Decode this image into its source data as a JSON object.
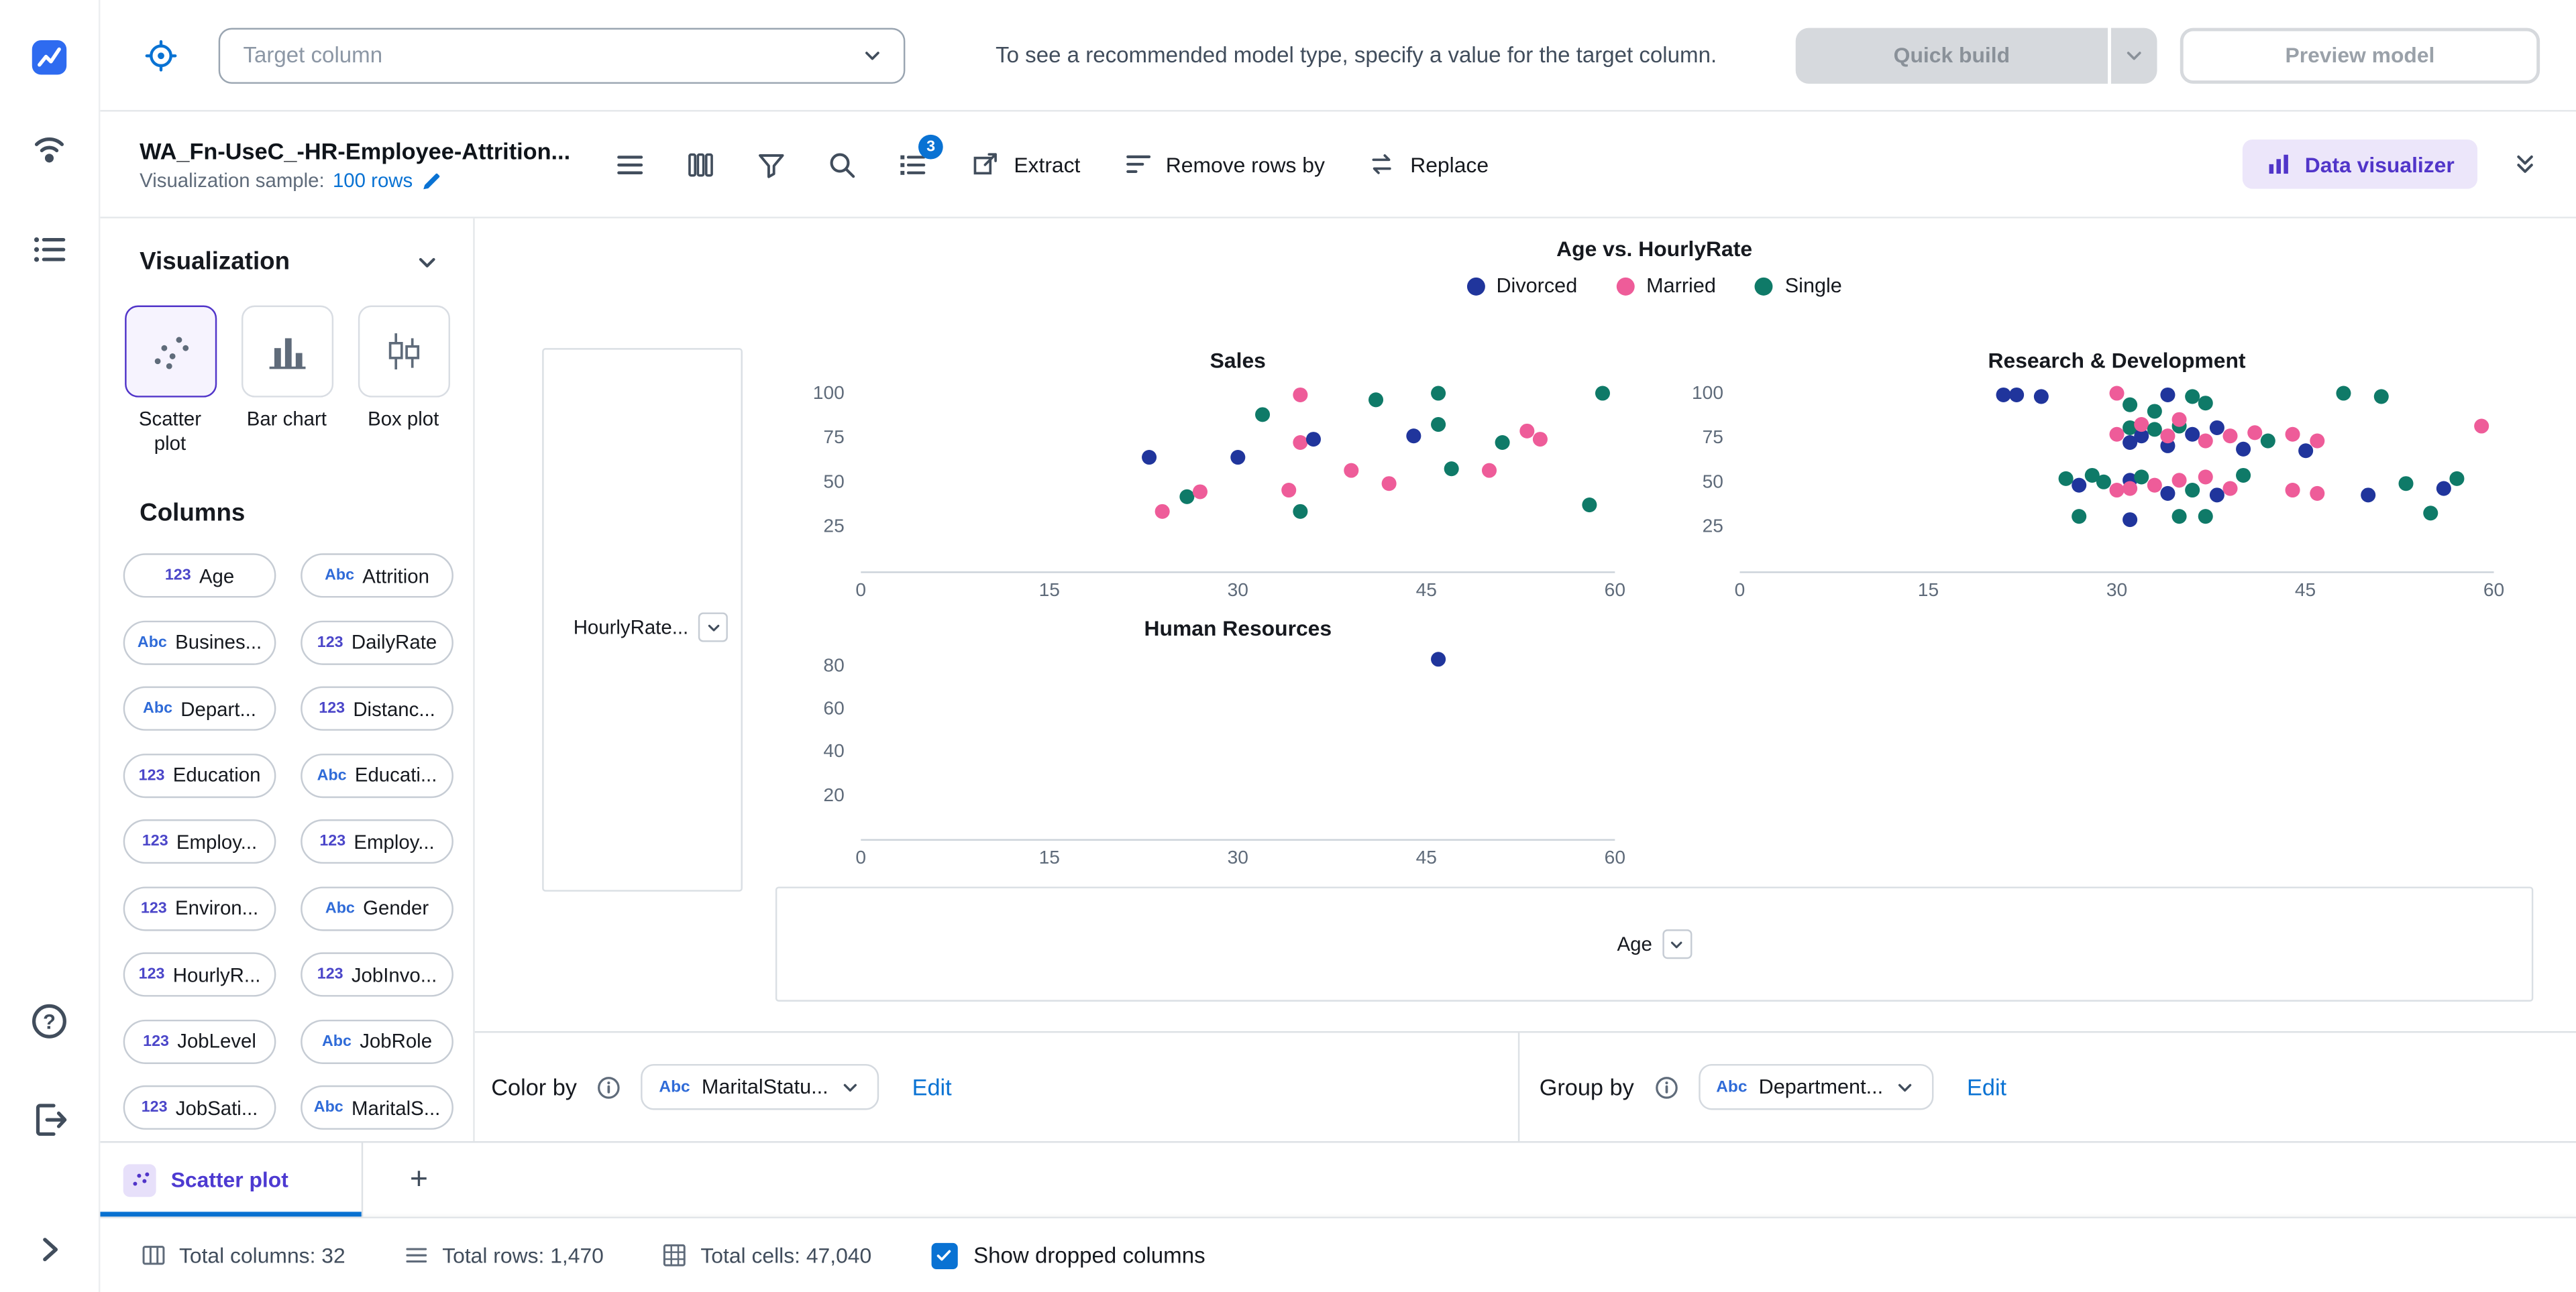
{
  "colors": {
    "accent": "#5135c9",
    "accent_bg": "#ece6fa",
    "link": "#0972d3",
    "disabled_bg": "#d6d9dd"
  },
  "header": {
    "target_placeholder": "Target column",
    "hint": "To see a recommended model type, specify a value for the target column.",
    "quick_build_label": "Quick build",
    "preview_model_label": "Preview model"
  },
  "toolbar": {
    "dataset_title": "WA_Fn-UseC_-HR-Employee-Attrition...",
    "sample_label": "Visualization sample:",
    "sample_value": "100 rows",
    "steps_badge": "3",
    "extract_label": "Extract",
    "remove_rows_label": "Remove rows by",
    "replace_label": "Replace",
    "data_visualizer_label": "Data visualizer"
  },
  "left_panel": {
    "visualization_title": "Visualization",
    "chart_types": [
      {
        "label": "Scatter plot",
        "selected": true
      },
      {
        "label": "Bar chart",
        "selected": false
      },
      {
        "label": "Box plot",
        "selected": false
      }
    ],
    "columns_title": "Columns",
    "columns": [
      {
        "kind": "123",
        "label": "Age"
      },
      {
        "kind": "Abc",
        "label": "Attrition"
      },
      {
        "kind": "Abc",
        "label": "Busines..."
      },
      {
        "kind": "123",
        "label": "DailyRate"
      },
      {
        "kind": "Abc",
        "label": "Depart..."
      },
      {
        "kind": "123",
        "label": "Distanc..."
      },
      {
        "kind": "123",
        "label": "Education"
      },
      {
        "kind": "Abc",
        "label": "Educati..."
      },
      {
        "kind": "123",
        "label": "Employ..."
      },
      {
        "kind": "123",
        "label": "Employ..."
      },
      {
        "kind": "123",
        "label": "Environ..."
      },
      {
        "kind": "Abc",
        "label": "Gender"
      },
      {
        "kind": "123",
        "label": "HourlyR..."
      },
      {
        "kind": "123",
        "label": "JobInvo..."
      },
      {
        "kind": "123",
        "label": "JobLevel"
      },
      {
        "kind": "Abc",
        "label": "JobRole"
      },
      {
        "kind": "123",
        "label": "JobSati..."
      },
      {
        "kind": "Abc",
        "label": "MaritalS..."
      }
    ]
  },
  "chart_data": {
    "type": "scatter",
    "title": "Age vs. HourlyRate",
    "xlabel": "Age",
    "ylabel": "HourlyRate",
    "y_selector": "HourlyRate...",
    "x_selector": "Age",
    "legend_position": "top",
    "legend": [
      {
        "label": "Divorced",
        "color": "#20359c"
      },
      {
        "label": "Married",
        "color": "#ee5c99"
      },
      {
        "label": "Single",
        "color": "#0f7a68"
      }
    ],
    "facets": [
      {
        "title": "Sales",
        "xlim": [
          0,
          60
        ],
        "ylim": [
          0,
          107
        ],
        "xticks": [
          0,
          15,
          30,
          45,
          60
        ],
        "yticks": [
          25,
          50,
          75,
          100
        ],
        "points": [
          [
            23,
            64,
            "Divorced"
          ],
          [
            24,
            34,
            "Married"
          ],
          [
            26,
            42,
            "Single"
          ],
          [
            27,
            45,
            "Married"
          ],
          [
            30,
            64,
            "Divorced"
          ],
          [
            32,
            88,
            "Single"
          ],
          [
            34,
            46,
            "Married"
          ],
          [
            35,
            72,
            "Married"
          ],
          [
            35,
            99,
            "Married"
          ],
          [
            35,
            34,
            "Single"
          ],
          [
            36,
            74,
            "Divorced"
          ],
          [
            39,
            57,
            "Married"
          ],
          [
            41,
            96,
            "Single"
          ],
          [
            42,
            49,
            "Married"
          ],
          [
            44,
            76,
            "Divorced"
          ],
          [
            46,
            83,
            "Single"
          ],
          [
            46,
            100,
            "Single"
          ],
          [
            47,
            58,
            "Single"
          ],
          [
            50,
            57,
            "Married"
          ],
          [
            51,
            72,
            "Single"
          ],
          [
            53,
            79,
            "Married"
          ],
          [
            54,
            74,
            "Married"
          ],
          [
            58,
            37,
            "Single"
          ],
          [
            59,
            100,
            "Single"
          ]
        ]
      },
      {
        "title": "Research & Development",
        "xlim": [
          0,
          60
        ],
        "ylim": [
          0,
          107
        ],
        "xticks": [
          0,
          15,
          30,
          45,
          60
        ],
        "yticks": [
          25,
          50,
          75,
          100
        ],
        "points": [
          [
            21,
            99,
            "Divorced"
          ],
          [
            22,
            99,
            "Divorced"
          ],
          [
            24,
            98,
            "Divorced"
          ],
          [
            30,
            100,
            "Married"
          ],
          [
            31,
            94,
            "Single"
          ],
          [
            33,
            90,
            "Single"
          ],
          [
            34,
            99,
            "Divorced"
          ],
          [
            36,
            98,
            "Single"
          ],
          [
            37,
            95,
            "Single"
          ],
          [
            48,
            100,
            "Single"
          ],
          [
            51,
            98,
            "Single"
          ],
          [
            30,
            77,
            "Married"
          ],
          [
            31,
            72,
            "Divorced"
          ],
          [
            31,
            81,
            "Single"
          ],
          [
            32,
            76,
            "Divorced"
          ],
          [
            32,
            83,
            "Married"
          ],
          [
            33,
            80,
            "Single"
          ],
          [
            34,
            71,
            "Divorced"
          ],
          [
            34,
            76,
            "Married"
          ],
          [
            35,
            82,
            "Single"
          ],
          [
            35,
            85,
            "Married"
          ],
          [
            36,
            77,
            "Divorced"
          ],
          [
            37,
            73,
            "Married"
          ],
          [
            38,
            81,
            "Divorced"
          ],
          [
            39,
            76,
            "Married"
          ],
          [
            40,
            69,
            "Divorced"
          ],
          [
            41,
            78,
            "Married"
          ],
          [
            42,
            73,
            "Single"
          ],
          [
            44,
            77,
            "Married"
          ],
          [
            45,
            68,
            "Divorced"
          ],
          [
            46,
            73,
            "Married"
          ],
          [
            59,
            82,
            "Married"
          ],
          [
            26,
            52,
            "Single"
          ],
          [
            27,
            48,
            "Divorced"
          ],
          [
            28,
            54,
            "Single"
          ],
          [
            29,
            50,
            "Single"
          ],
          [
            30,
            46,
            "Married"
          ],
          [
            31,
            51,
            "Divorced"
          ],
          [
            31,
            47,
            "Married"
          ],
          [
            32,
            53,
            "Single"
          ],
          [
            33,
            48,
            "Married"
          ],
          [
            34,
            44,
            "Divorced"
          ],
          [
            35,
            51,
            "Married"
          ],
          [
            36,
            46,
            "Single"
          ],
          [
            37,
            53,
            "Married"
          ],
          [
            38,
            43,
            "Divorced"
          ],
          [
            39,
            47,
            "Married"
          ],
          [
            40,
            54,
            "Single"
          ],
          [
            44,
            46,
            "Married"
          ],
          [
            46,
            44,
            "Married"
          ],
          [
            50,
            43,
            "Divorced"
          ],
          [
            53,
            49,
            "Single"
          ],
          [
            55,
            33,
            "Single"
          ],
          [
            56,
            47,
            "Divorced"
          ],
          [
            57,
            52,
            "Single"
          ],
          [
            27,
            31,
            "Single"
          ],
          [
            31,
            29,
            "Divorced"
          ],
          [
            35,
            31,
            "Single"
          ],
          [
            37,
            31,
            "Single"
          ]
        ]
      },
      {
        "title": "Human Resources",
        "xlim": [
          0,
          60
        ],
        "ylim": [
          0,
          88
        ],
        "xticks": [
          0,
          15,
          30,
          45,
          60
        ],
        "yticks": [
          20,
          40,
          60,
          80
        ],
        "points": [
          [
            46,
            83,
            "Divorced"
          ]
        ]
      }
    ]
  },
  "controls": {
    "color_by": {
      "label": "Color by",
      "kind": "Abc",
      "value": "MaritalStatu...",
      "edit": "Edit"
    },
    "group_by": {
      "label": "Group by",
      "kind": "Abc",
      "value": "Department...",
      "edit": "Edit"
    }
  },
  "tabs": {
    "active_label": "Scatter plot",
    "add_label": "+"
  },
  "statusbar": {
    "total_columns": "Total columns: 32",
    "total_rows": "Total rows: 1,470",
    "total_cells": "Total cells: 47,040",
    "show_dropped": "Show dropped columns",
    "checked": true
  }
}
